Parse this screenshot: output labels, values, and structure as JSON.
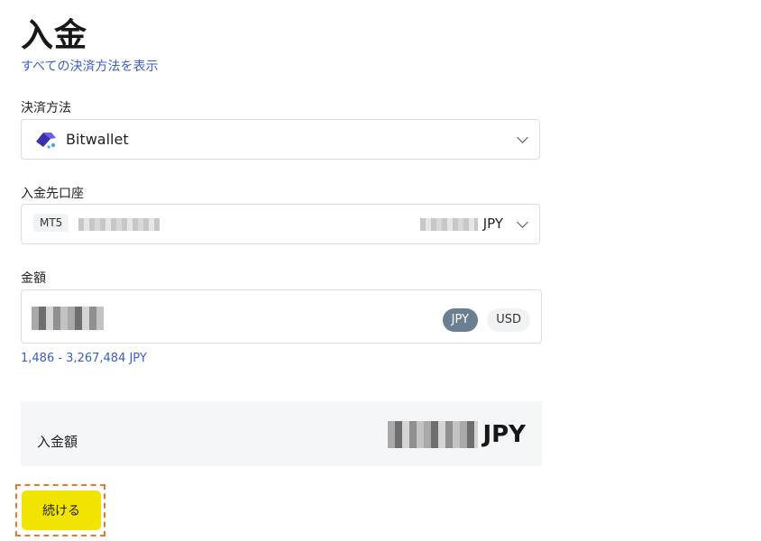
{
  "page": {
    "title": "入金",
    "show_all_methods_link": "すべての決済方法を表示"
  },
  "payment_method": {
    "label": "決済方法",
    "selected": "Bitwallet",
    "icon": "bitwallet-logo-icon"
  },
  "deposit_account": {
    "label": "入金先口座",
    "platform_tag": "MT5",
    "currency": "JPY"
  },
  "amount": {
    "label": "金額",
    "currency_options": [
      "JPY",
      "USD"
    ],
    "selected_currency": "JPY",
    "range_text": "1,486 - 3,267,484 JPY"
  },
  "summary": {
    "label": "入金額",
    "currency": "JPY"
  },
  "actions": {
    "continue_label": "続ける"
  },
  "colors": {
    "link": "#3a5fc0",
    "primary_button": "#f0e400",
    "active_pill": "#6b7f92",
    "focus_outline": "#e8792a"
  }
}
